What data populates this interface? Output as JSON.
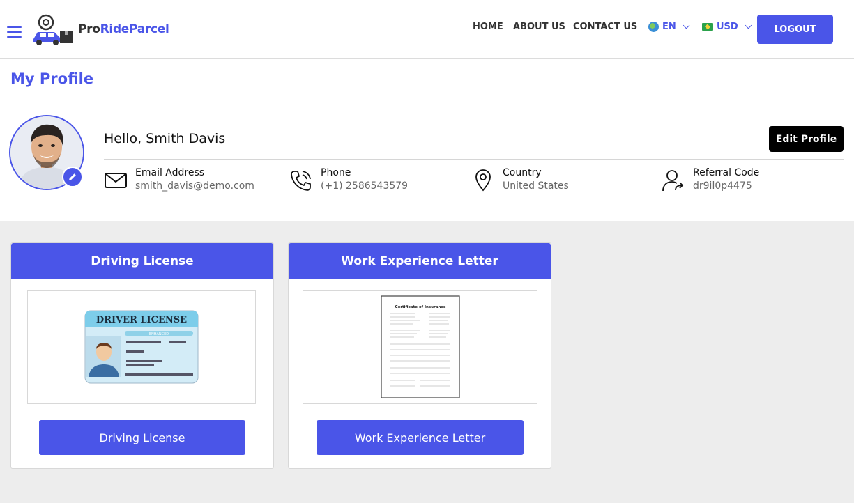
{
  "brand": {
    "name_part1": "Pro",
    "name_part2": "RideParcel"
  },
  "nav": {
    "home": "HOME",
    "about": "ABOUT US",
    "contact": "CONTACT US",
    "language": "EN",
    "currency": "USD",
    "logout": "LOGOUT"
  },
  "page": {
    "title": "My Profile"
  },
  "profile": {
    "greeting": "Hello, Smith Davis",
    "edit_label": "Edit Profile",
    "email_label": "Email Address",
    "email_value": "smith_davis@demo.com",
    "phone_label": "Phone",
    "phone_value": "(+1) 2586543579",
    "country_label": "Country",
    "country_value": "United States",
    "referral_label": "Referral Code",
    "referral_value": "dr9il0p4475"
  },
  "documents": [
    {
      "title": "Driving License",
      "button": "Driving License",
      "image_text": "DRIVER LICENSE",
      "image_sub": "ENHANCED"
    },
    {
      "title": "Work Experience Letter",
      "button": "Work Experience Letter",
      "image_text": "Certificate of Insurance"
    }
  ],
  "colors": {
    "accent": "#4a55e8",
    "background": "#ededed",
    "dark_button": "#000000"
  },
  "icons": [
    "menu-icon",
    "logo-icon",
    "globe-icon",
    "flag-icon",
    "chevron-down-icon",
    "pencil-icon",
    "mail-icon",
    "phone-icon",
    "location-icon",
    "user-share-icon"
  ]
}
